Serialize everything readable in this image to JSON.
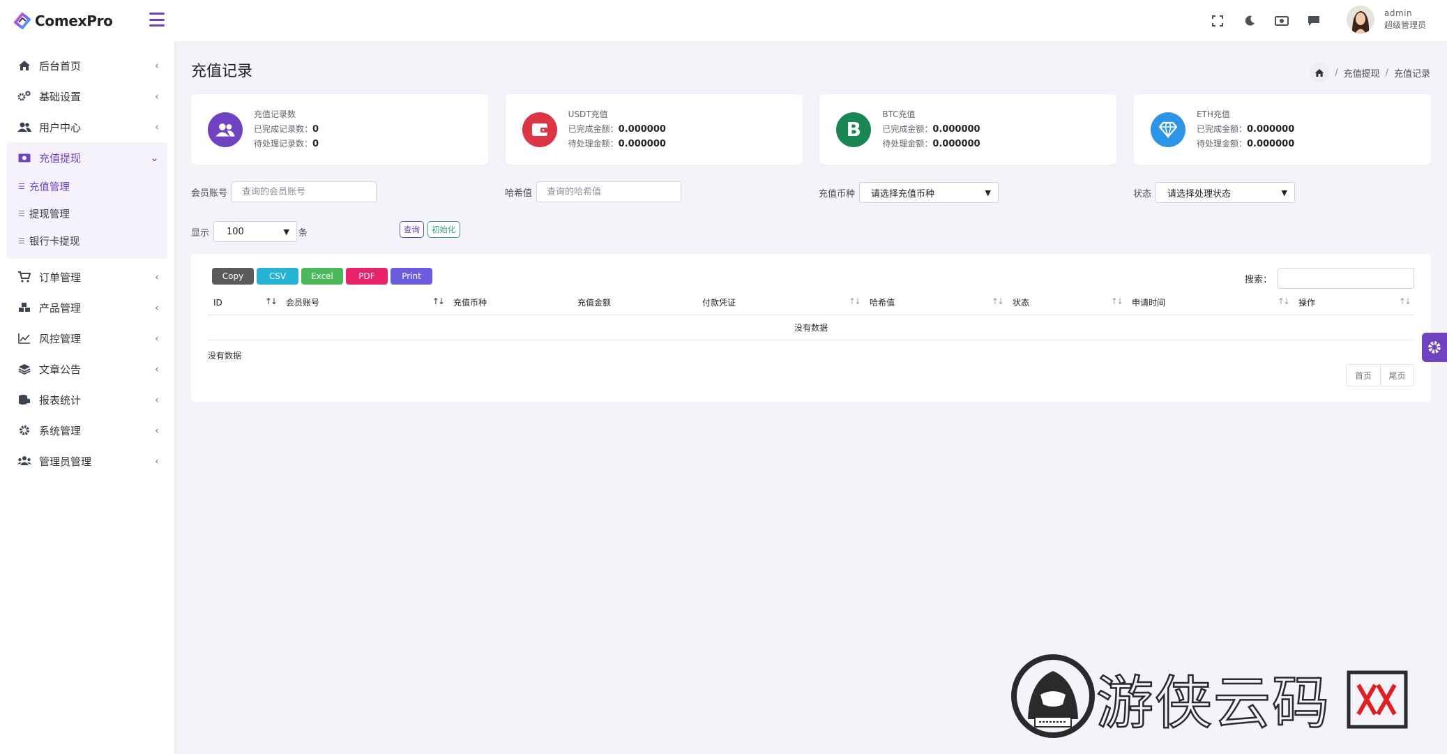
{
  "app": {
    "name": "ComexPro"
  },
  "sidebar": {
    "items": [
      {
        "label": "后台首页",
        "icon": "home-icon"
      },
      {
        "label": "基础设置",
        "icon": "cogs-icon"
      },
      {
        "label": "用户中心",
        "icon": "users-icon"
      },
      {
        "label": "充值提现",
        "icon": "money-bill-icon",
        "expanded": true,
        "children": [
          {
            "label": "充值管理",
            "active": true
          },
          {
            "label": "提现管理"
          },
          {
            "label": "银行卡提现"
          }
        ]
      },
      {
        "label": "订单管理",
        "icon": "cart-icon"
      },
      {
        "label": "产品管理",
        "icon": "cubes-icon"
      },
      {
        "label": "风控管理",
        "icon": "line-chart-icon"
      },
      {
        "label": "文章公告",
        "icon": "layers-icon"
      },
      {
        "label": "报表统计",
        "icon": "coins-icon"
      },
      {
        "label": "系统管理",
        "icon": "gear-icon"
      },
      {
        "label": "管理员管理",
        "icon": "user-group-icon"
      }
    ]
  },
  "topbar": {
    "user_name": "admin",
    "user_role": "超级管理员"
  },
  "page": {
    "title": "充值记录",
    "breadcrumb": [
      "充值提现",
      "充值记录"
    ]
  },
  "cards": [
    {
      "title": "充值记录数",
      "line1_label": "已完成记录数：",
      "line1_value": "0",
      "line2_label": "待处理记录数：",
      "line2_value": "0",
      "color": "#6f42c1"
    },
    {
      "title": "USDT充值",
      "line1_label": "已完成金额：",
      "line1_value": "0.000000",
      "line2_label": "待处理金额：",
      "line2_value": "0.000000",
      "color": "#dc3545"
    },
    {
      "title": "BTC充值",
      "line1_label": "已完成金额：",
      "line1_value": "0.000000",
      "line2_label": "待处理金额：",
      "line2_value": "0.000000",
      "color": "#198754"
    },
    {
      "title": "ETH充值",
      "line1_label": "已完成金额：",
      "line1_value": "0.000000",
      "line2_label": "待处理金额：",
      "line2_value": "0.000000",
      "color": "#2c95e8"
    }
  ],
  "filters": {
    "member_label": "会员账号",
    "member_placeholder": "查询的会员账号",
    "hash_label": "哈希值",
    "hash_placeholder": "查询的哈希值",
    "coin_label": "充值币种",
    "coin_value": "请选择充值币种",
    "status_label": "状态",
    "status_value": "请选择处理状态",
    "show_label": "显示",
    "show_value": "100",
    "show_unit": "条",
    "query_label": "查询",
    "reset_label": "初始化"
  },
  "table": {
    "export_buttons": [
      {
        "label": "Copy",
        "color": "#5a5a5a"
      },
      {
        "label": "CSV",
        "color": "#26b3d4"
      },
      {
        "label": "Excel",
        "color": "#4cb85c"
      },
      {
        "label": "PDF",
        "color": "#e8236a"
      },
      {
        "label": "Print",
        "color": "#6b5be0"
      }
    ],
    "search_label": "搜索：",
    "columns": [
      "ID",
      "会员账号",
      "充值币种",
      "充值金额",
      "付款凭证",
      "哈希值",
      "状态",
      "申请时间",
      "操作"
    ],
    "empty_text": "没有数据",
    "info_text": "没有数据",
    "pager": {
      "first": "首页",
      "last": "尾页"
    }
  },
  "watermark": {
    "text": "游侠云码网"
  },
  "colors": {
    "accent": "#6f42c1",
    "background": "#f3f3f9"
  }
}
